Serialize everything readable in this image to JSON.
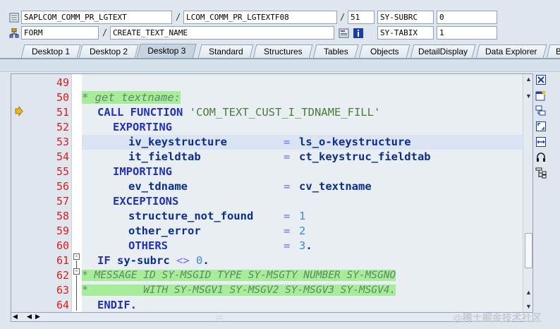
{
  "header": {
    "row1": {
      "program": "SAPLCOM_COMM_PR_LGTEXT",
      "include": "LCOM_COMM_PR_LGTEXTF08",
      "line": "51",
      "sysvar_name": "SY-SUBRC",
      "sysvar_value": "0"
    },
    "row2": {
      "type": "FORM",
      "name": "CREATE_TEXT_NAME",
      "sysvar_name": "SY-TABIX",
      "sysvar_value": "1"
    }
  },
  "tabs": [
    {
      "label": "Desktop 1"
    },
    {
      "label": "Desktop 2"
    },
    {
      "label": "Desktop 3"
    },
    {
      "label": "Standard"
    },
    {
      "label": "Structures"
    },
    {
      "label": "Tables"
    },
    {
      "label": "Objects"
    },
    {
      "label": "DetailDisplay"
    },
    {
      "label": "Data Explorer"
    },
    {
      "label": "B"
    }
  ],
  "active_tab": "Desktop 3",
  "editor": {
    "current_line": "51",
    "lines": [
      {
        "no": "49"
      },
      {
        "no": "50"
      },
      {
        "no": "51"
      },
      {
        "no": "52"
      },
      {
        "no": "53"
      },
      {
        "no": "54"
      },
      {
        "no": "55"
      },
      {
        "no": "56"
      },
      {
        "no": "57"
      },
      {
        "no": "58"
      },
      {
        "no": "59"
      },
      {
        "no": "60"
      },
      {
        "no": "61"
      },
      {
        "no": "62"
      },
      {
        "no": "63"
      },
      {
        "no": "64"
      }
    ],
    "code": {
      "l50": "* get textname:",
      "l51_kw": "CALL FUNCTION",
      "l51_str": "'COM_TEXT_CUST_I_TDNAME_FILL'",
      "l52": "EXPORTING",
      "l53_param": "iv_keystructure",
      "l53_eq": "=",
      "l53_val": "ls_o-keystructure",
      "l54_param": "it_fieldtab",
      "l54_eq": "=",
      "l54_val": "ct_keystruc_fieldtab",
      "l55": "IMPORTING",
      "l56_param": "ev_tdname",
      "l56_eq": "=",
      "l56_val": "cv_textname",
      "l57": "EXCEPTIONS",
      "l58_param": "structure_not_found",
      "l58_eq": "=",
      "l58_val": "1",
      "l59_param": "other_error",
      "l59_eq": "=",
      "l59_val": "2",
      "l60_param": "OTHERS",
      "l60_eq": "=",
      "l60_val": "3",
      "l60_end": ".",
      "l61_kw": "IF",
      "l61_var": "sy-subrc",
      "l61_op": "<>",
      "l61_val": "0",
      "l61_end": ".",
      "l62": "* MESSAGE ID SY-MSGID TYPE SY-MSGTY NUMBER SY-MSGNO",
      "l63": "*         WITH SY-MSGV1 SY-MSGV2 SY-MSGV3 SY-MSGV4.",
      "l64": "ENDIF."
    }
  },
  "watermark": "@稀土掘金技术社区",
  "colors": {
    "line_number": "#d81e1e",
    "keyword": "#2232b8",
    "comment_bg": "#a6ec9b",
    "current_line_marker": "#f2b21c"
  }
}
